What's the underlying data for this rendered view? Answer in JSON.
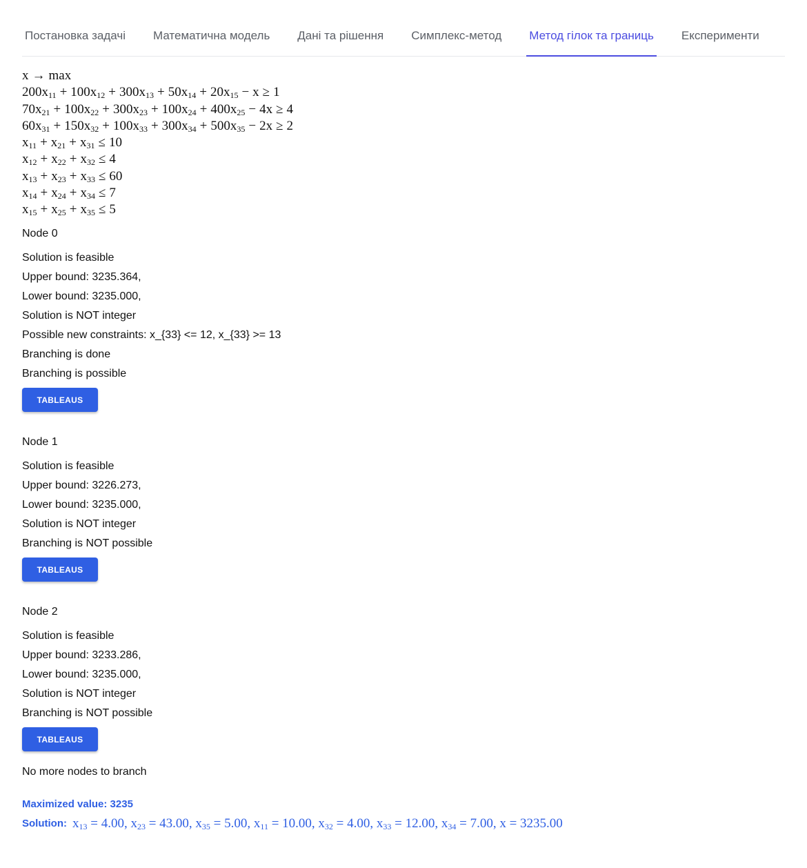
{
  "tabs": [
    {
      "label": "Постановка задачі",
      "active": false
    },
    {
      "label": "Математична модель",
      "active": false
    },
    {
      "label": "Дані та рішення",
      "active": false
    },
    {
      "label": "Симплекс-метод",
      "active": false
    },
    {
      "label": "Метод гілок та границь",
      "active": true
    },
    {
      "label": "Експерименти",
      "active": false
    }
  ],
  "model": {
    "objective": {
      "var": "x",
      "arrow": "→",
      "goal": "max"
    },
    "constraints": [
      {
        "terms": [
          [
            "200",
            "11"
          ],
          [
            "100",
            "12"
          ],
          [
            "300",
            "13"
          ],
          [
            "50",
            "14"
          ],
          [
            "20",
            "15"
          ]
        ],
        "tail_coef": "",
        "rel": "≥",
        "rhs": "1"
      },
      {
        "terms": [
          [
            "70",
            "21"
          ],
          [
            "100",
            "22"
          ],
          [
            "300",
            "23"
          ],
          [
            "100",
            "24"
          ],
          [
            "400",
            "25"
          ]
        ],
        "tail_coef": "4",
        "rel": "≥",
        "rhs": "4"
      },
      {
        "terms": [
          [
            "60",
            "31"
          ],
          [
            "150",
            "32"
          ],
          [
            "100",
            "33"
          ],
          [
            "300",
            "34"
          ],
          [
            "500",
            "35"
          ]
        ],
        "tail_coef": "2",
        "rel": "≥",
        "rhs": "2"
      },
      {
        "terms": [
          [
            "",
            "11"
          ],
          [
            "",
            "21"
          ],
          [
            "",
            "31"
          ]
        ],
        "tail_coef": null,
        "rel": "≤",
        "rhs": "10"
      },
      {
        "terms": [
          [
            "",
            "12"
          ],
          [
            "",
            "22"
          ],
          [
            "",
            "32"
          ]
        ],
        "tail_coef": null,
        "rel": "≤",
        "rhs": "4"
      },
      {
        "terms": [
          [
            "",
            "13"
          ],
          [
            "",
            "23"
          ],
          [
            "",
            "33"
          ]
        ],
        "tail_coef": null,
        "rel": "≤",
        "rhs": "60"
      },
      {
        "terms": [
          [
            "",
            "14"
          ],
          [
            "",
            "24"
          ],
          [
            "",
            "34"
          ]
        ],
        "tail_coef": null,
        "rel": "≤",
        "rhs": "7"
      },
      {
        "terms": [
          [
            "",
            "15"
          ],
          [
            "",
            "25"
          ],
          [
            "",
            "35"
          ]
        ],
        "tail_coef": null,
        "rel": "≤",
        "rhs": "5"
      }
    ]
  },
  "nodes": [
    {
      "title": "Node 0",
      "lines": [
        "Solution is feasible",
        "Upper bound: 3235.364,",
        "Lower bound: 3235.000,",
        "Solution is NOT integer",
        "Possible new constraints: x_{33} <= 12, x_{33} >= 13",
        "Branching is done",
        "Branching is possible"
      ],
      "button": "TABLEAUS"
    },
    {
      "title": "Node 1",
      "lines": [
        "Solution is feasible",
        "Upper bound: 3226.273,",
        "Lower bound: 3235.000,",
        "Solution is NOT integer",
        "Branching is NOT possible"
      ],
      "button": "TABLEAUS"
    },
    {
      "title": "Node 2",
      "lines": [
        "Solution is feasible",
        "Upper bound: 3233.286,",
        "Lower bound: 3235.000,",
        "Solution is NOT integer",
        "Branching is NOT possible"
      ],
      "button": "TABLEAUS"
    }
  ],
  "final_note": "No more nodes to branch",
  "result": {
    "max_label": "Maximized value: 3235",
    "solution_label": "Solution:",
    "solution": [
      {
        "sub": "13",
        "value": "4.00"
      },
      {
        "sub": "23",
        "value": "43.00"
      },
      {
        "sub": "35",
        "value": "5.00"
      },
      {
        "sub": "11",
        "value": "10.00"
      },
      {
        "sub": "32",
        "value": "4.00"
      },
      {
        "sub": "33",
        "value": "12.00"
      },
      {
        "sub": "34",
        "value": "7.00"
      },
      {
        "sub": "",
        "value": "3235.00"
      }
    ]
  },
  "colors": {
    "accent": "#4b4ce0",
    "button": "#2f5fe3",
    "result": "#2f5fe3"
  }
}
